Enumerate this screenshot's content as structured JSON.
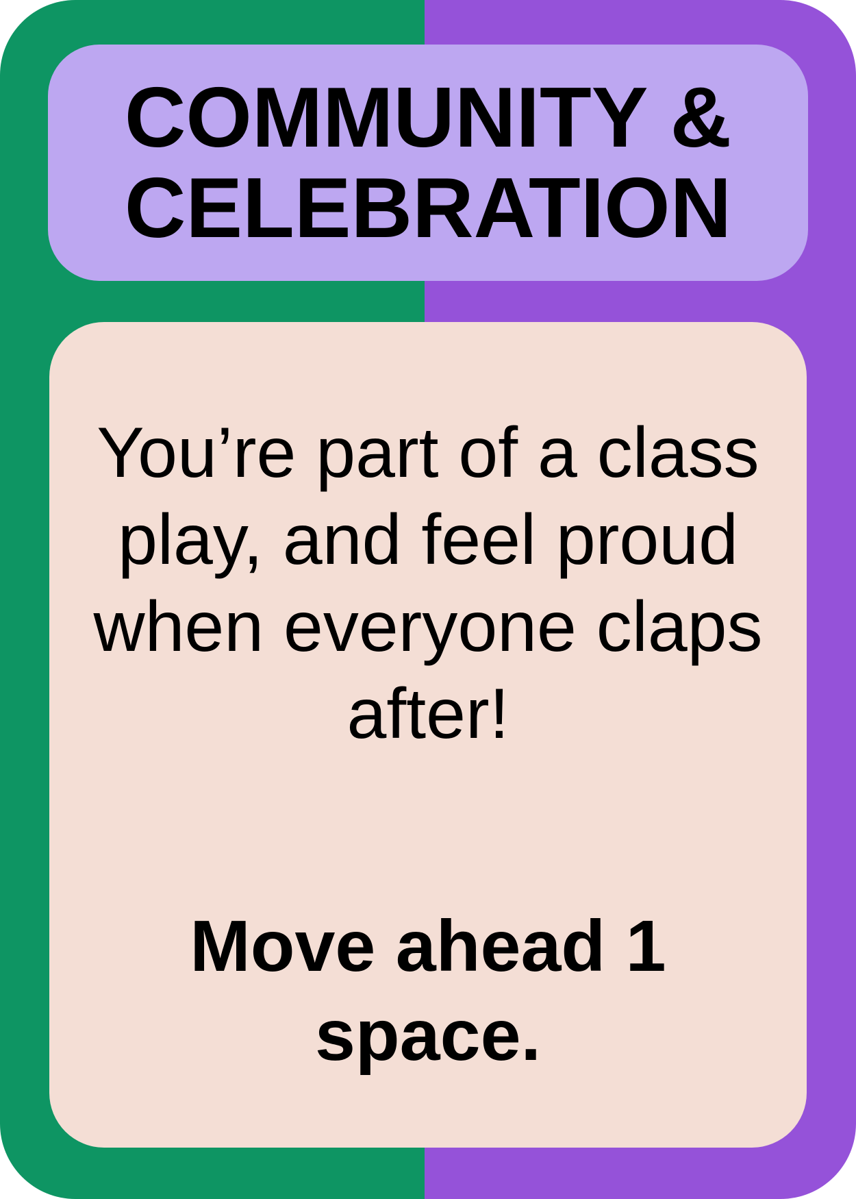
{
  "card": {
    "category": "COMMUNITY &\nCELEBRATION",
    "description": "You’re part of a class play, and feel proud when everyone claps after!",
    "action": "Move ahead 1 space."
  },
  "colors": {
    "left_border": "#0E9563",
    "right_border": "#9552D9",
    "title_panel": "#BDA7F1",
    "body_panel": "#F4DED5",
    "text": "#000000"
  }
}
